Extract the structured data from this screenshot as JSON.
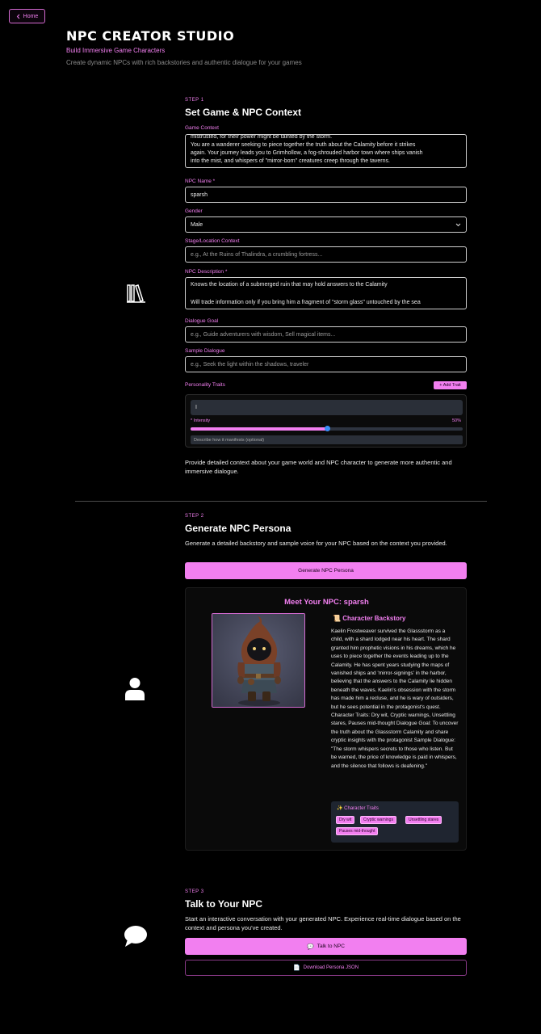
{
  "header": {
    "home_label": "Home",
    "title": "NPC CREATOR STUDIO",
    "subtitle": "Build Immersive Game Characters",
    "description": "Create dynamic NPCs with rich backstories and authentic dialogue for your games"
  },
  "step1": {
    "step_label": "STEP 1",
    "title": "Set Game & NPC Context",
    "game_context_label": "Game Context",
    "game_context_lines": [
      "mistrusted, for their power might be tainted by the storm.",
      "You are a wanderer seeking to piece together the truth about the Calamity before it strikes",
      "again. Your journey leads you to Grimhollow, a fog-shrouded harbor town where ships vanish",
      "into the mist, and whispers of \"mirror-born\" creatures creep through the taverns."
    ],
    "npc_name_label": "NPC Name *",
    "npc_name_value": "sparsh",
    "gender_label": "Gender",
    "gender_value": "Male",
    "stage_label": "Stage/Location Context",
    "stage_placeholder": "e.g., At the Ruins of Thalindra, a crumbling fortress...",
    "npc_description_label": "NPC Description *",
    "npc_description_lines": [
      "Knows the location of a submerged ruin that may hold answers to the Calamity",
      "",
      "Will trade information only if you bring him a fragment of \"storm glass\" untouched by the sea"
    ],
    "dialogue_goal_label": "Dialogue Goal",
    "dialogue_goal_placeholder": "e.g., Guide adventurers with wisdom, Sell magical items...",
    "sample_dialogue_label": "Sample Dialogue",
    "sample_dialogue_placeholder": "e.g., Seek the light within the shadows, traveler",
    "personality_traits_label": "Personality Traits",
    "add_trait_label": "+ Add Trait",
    "trait_value": "I",
    "intensity_label": "* Intensity",
    "intensity_value": "50%",
    "intensity_fraction": 0.5,
    "trait_description_placeholder": "Describe how it manifests (optional)",
    "help_text": "Provide detailed context about your game world and NPC character to generate more authentic and immersive dialogue."
  },
  "step2": {
    "step_label": "STEP 2",
    "title": "Generate NPC Persona",
    "description": "Generate a detailed backstory and sample voice for your NPC based on the context you provided.",
    "generate_button": "Generate NPC Persona",
    "meet_title": "Meet Your NPC: sparsh",
    "backstory_title": "Character Backstory",
    "backstory_text": "Kaelin Frostweaver survived the Glassstorm as a child, with a shard lodged near his heart. The shard granted him prophetic visions in his dreams, which he uses to piece together the events leading up to the Calamity. He has spent years studying the maps of vanished ships and 'mirror-signings' in the harbor, believing that the answers to the Calamity lie hidden beneath the waves. Kaelin's obsession with the storm has made him a recluse, and he is wary of outsiders, but he sees potential in the protagonist's quest. Character Traits: Dry wit, Cryptic warnings, Unsettling stares, Pauses mid-thought Dialogue Goal: To uncover the truth about the Glassstorm Calamity and share cryptic insights with the protagonist Sample Dialogue: \"The storm whispers secrets to those who listen. But be warned, the price of knowledge is paid in whispers, and the silence that follows is deafening.\"",
    "character_traits_title": "Character Traits",
    "traits": [
      "Dry wit",
      "Cryptic warnings",
      "Unsettling stares",
      "Pauses mid-thought"
    ]
  },
  "step3": {
    "step_label": "STEP 3",
    "title": "Talk to Your NPC",
    "description": "Start an interactive conversation with your generated NPC. Experience real-time dialogue based on the context and persona you've created.",
    "talk_button": "Talk to NPC",
    "download_button": "Download Persona JSON"
  },
  "icons": {
    "home": "chevron-left-icon",
    "step1": "books-icon",
    "step2": "user-icon",
    "step3": "chat-bubble-icon"
  },
  "colors": {
    "accent": "#f27ff0",
    "background": "#000000",
    "slider_thumb": "#3a8ef6"
  }
}
